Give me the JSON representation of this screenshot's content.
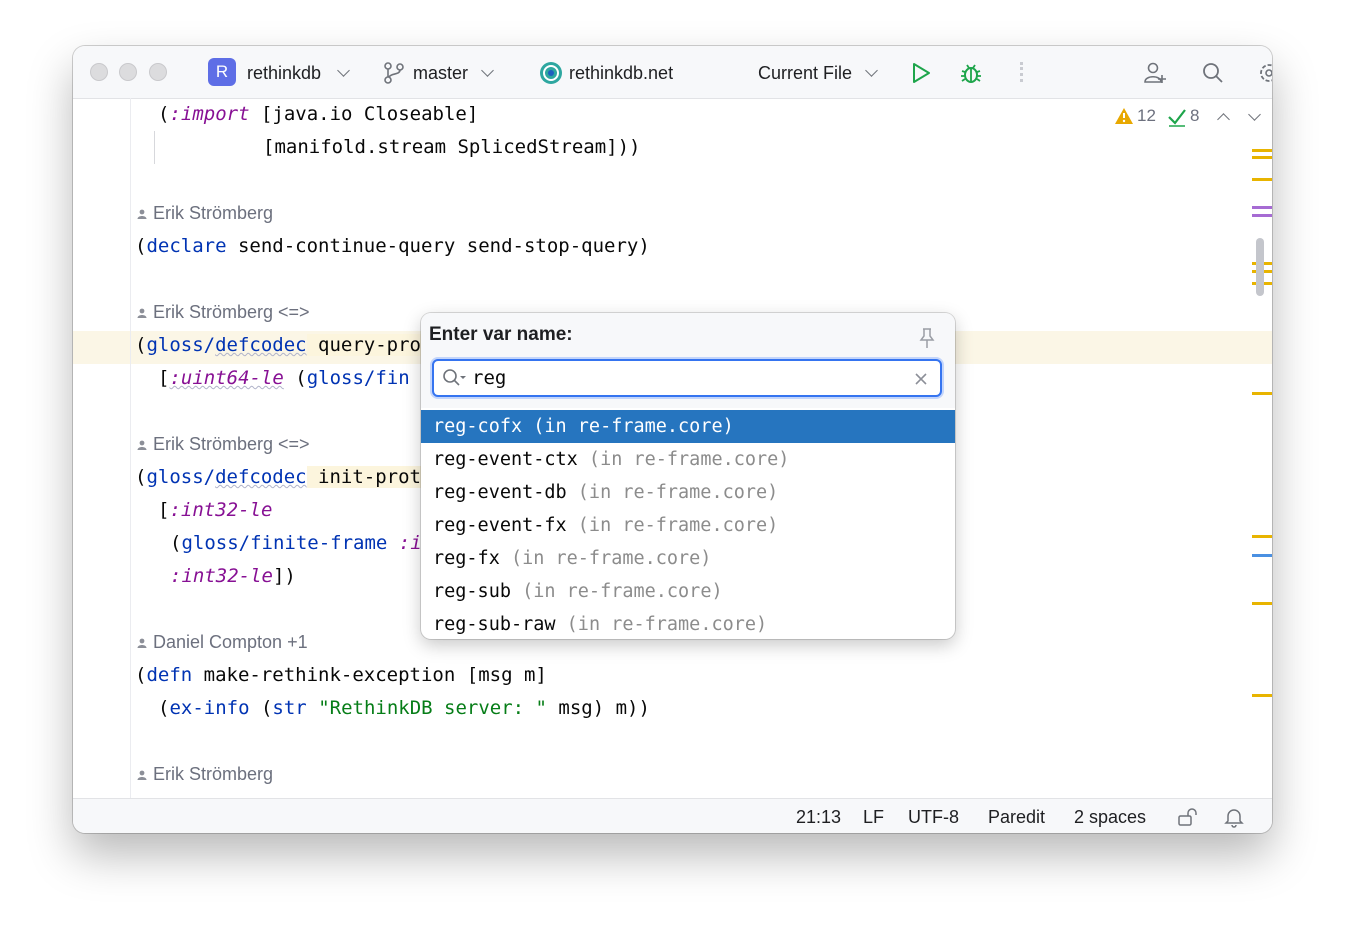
{
  "titlebar": {
    "project_initial": "R",
    "project_name": "rethinkdb",
    "branch": "master",
    "run_target": "rethinkdb.net",
    "run_config": "Current File"
  },
  "inspections": {
    "warnings": "12",
    "checks": "8"
  },
  "code": {
    "l1_open": "(",
    "l1_kw": ":import",
    "l1_rest": " [java.io Closeable]",
    "l2": "[manifold.stream SplicedStream]))",
    "author1": "Erik Strömberg",
    "l3_open": "(",
    "l3_kw": "declare",
    "l3_rest": " send-continue-query send-stop-query)",
    "author2": "Erik Strömberg <=>",
    "l4_open": "(",
    "l4_ns": "gloss/",
    "l4_fn": "defcodec",
    "l4_rest": " query-pro",
    "l5_open": "[",
    "l5_kw": ":uint64-le",
    "l5_mid": " (",
    "l5_fn": "gloss/fin",
    "author3": "Erik Strömberg <=>",
    "l6_open": "(",
    "l6_ns": "gloss/",
    "l6_fn": "defcodec",
    "l6_rest": " init-prot",
    "l7_open": "[",
    "l7_kw": ":int32-le",
    "l8_open": "(",
    "l8_fn": "gloss/finite-frame",
    "l8_kw": " :i",
    "l9_kw": ":int32-le",
    "l9_rest": "])",
    "author4": "Daniel Compton +1",
    "l10_open": "(",
    "l10_kw": "defn",
    "l10_rest": " make-rethink-exception [msg m]",
    "l11_open": "(",
    "l11_fn": "ex-info",
    "l11_mid": " (",
    "l11_fn2": "str",
    "l11_sp": " ",
    "l11_str": "\"RethinkDB server: \"",
    "l11_rest": " msg) m))",
    "author5": "Erik Strömberg"
  },
  "popup": {
    "title": "Enter var name:",
    "query": "reg",
    "items": [
      {
        "name": "reg-cofx",
        "loc": " (in re-frame.core)",
        "selected": true
      },
      {
        "name": "reg-event-ctx",
        "loc": " (in re-frame.core)"
      },
      {
        "name": "reg-event-db",
        "loc": " (in re-frame.core)"
      },
      {
        "name": "reg-event-fx",
        "loc": " (in re-frame.core)"
      },
      {
        "name": "reg-fx",
        "loc": " (in re-frame.core)"
      },
      {
        "name": "reg-sub",
        "loc": " (in re-frame.core)"
      },
      {
        "name": "reg-sub-raw",
        "loc": " (in re-frame.core)"
      }
    ]
  },
  "statusbar": {
    "position": "21:13",
    "line_sep": "LF",
    "encoding": "UTF-8",
    "mode": "Paredit",
    "indent": "2 spaces"
  },
  "colors": {
    "accent": "#3574f0",
    "selection": "#2675bf",
    "warning": "#e8b400",
    "keyword": "#0033b3",
    "keyword_italic": "#871094",
    "string": "#067d17"
  }
}
